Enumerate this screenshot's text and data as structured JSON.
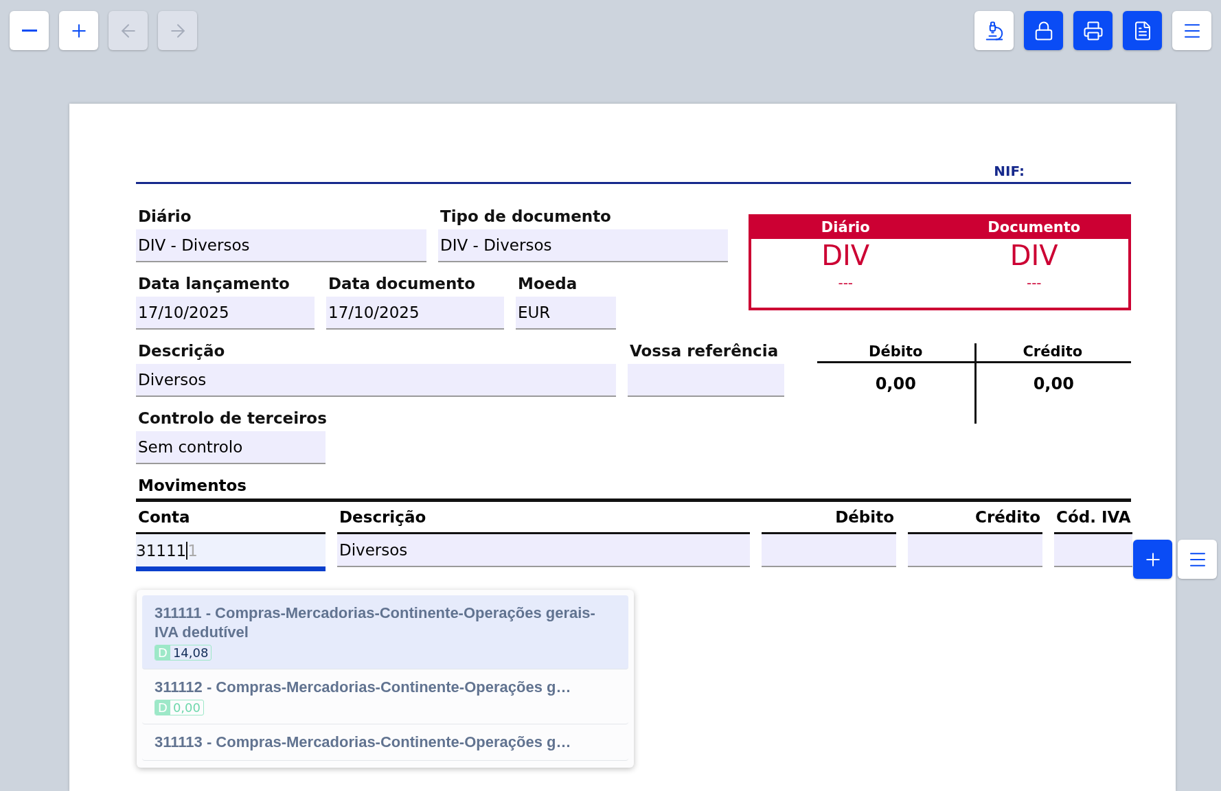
{
  "toolbar": {
    "left": [
      {
        "disabled": false,
        "filled": false
      },
      {
        "disabled": false,
        "filled": false
      },
      {
        "disabled": true,
        "filled": false
      },
      {
        "disabled": true,
        "filled": false
      }
    ],
    "right": [
      {
        "disabled": false,
        "filled": false
      },
      {
        "disabled": false,
        "filled": true
      },
      {
        "disabled": false,
        "filled": true
      },
      {
        "disabled": false,
        "filled": true
      },
      {
        "disabled": false,
        "filled": false
      }
    ]
  },
  "header": {
    "nif_label": "NIF:"
  },
  "fields": {
    "diario": {
      "label": "Diário",
      "value": "DIV - Diversos"
    },
    "tipo_documento": {
      "label": "Tipo de documento",
      "value": "DIV - Diversos"
    },
    "data_lancamento": {
      "label": "Data lançamento",
      "value": "17/10/2025"
    },
    "data_documento": {
      "label": "Data documento",
      "value": "17/10/2025"
    },
    "moeda": {
      "label": "Moeda",
      "value": "EUR"
    },
    "descricao": {
      "label": "Descrição",
      "value": "Diversos"
    },
    "vossa_referencia": {
      "label": "Vossa referência"
    },
    "controlo_terceiros": {
      "label": "Controlo de terceiros",
      "value": "Sem controlo"
    }
  },
  "codes_box": [
    {
      "title": "Diário",
      "code": "DIV",
      "number": "---"
    },
    {
      "title": "Documento",
      "code": "DIV",
      "number": "---"
    }
  ],
  "totals": [
    {
      "label": "Débito",
      "value": "0,00"
    },
    {
      "label": "Crédito",
      "value": "0,00"
    }
  ],
  "movimentos": {
    "title": "Movimentos",
    "columns": [
      {
        "label": "Conta"
      },
      {
        "label": "Descrição"
      },
      {
        "label": "Débito"
      },
      {
        "label": "Crédito"
      },
      {
        "label": "Cód. IVA"
      }
    ],
    "row": {
      "conta": "31111",
      "conta_suggestion": "1",
      "descricao": "Diversos"
    },
    "dropdown": [
      {
        "text": "311111 - Compras-Mercadorias-Continente-Operações gerais-IVA dedutível",
        "side": "D",
        "balance": "14,08",
        "selected": true
      },
      {
        "text": "311112 - Compras-Mercadorias-Continente-Operações g…",
        "side": "D",
        "balance": "0,00",
        "selected": false
      },
      {
        "text": "311113 - Compras-Mercadorias-Continente-Operações g…",
        "selected": false
      }
    ]
  }
}
